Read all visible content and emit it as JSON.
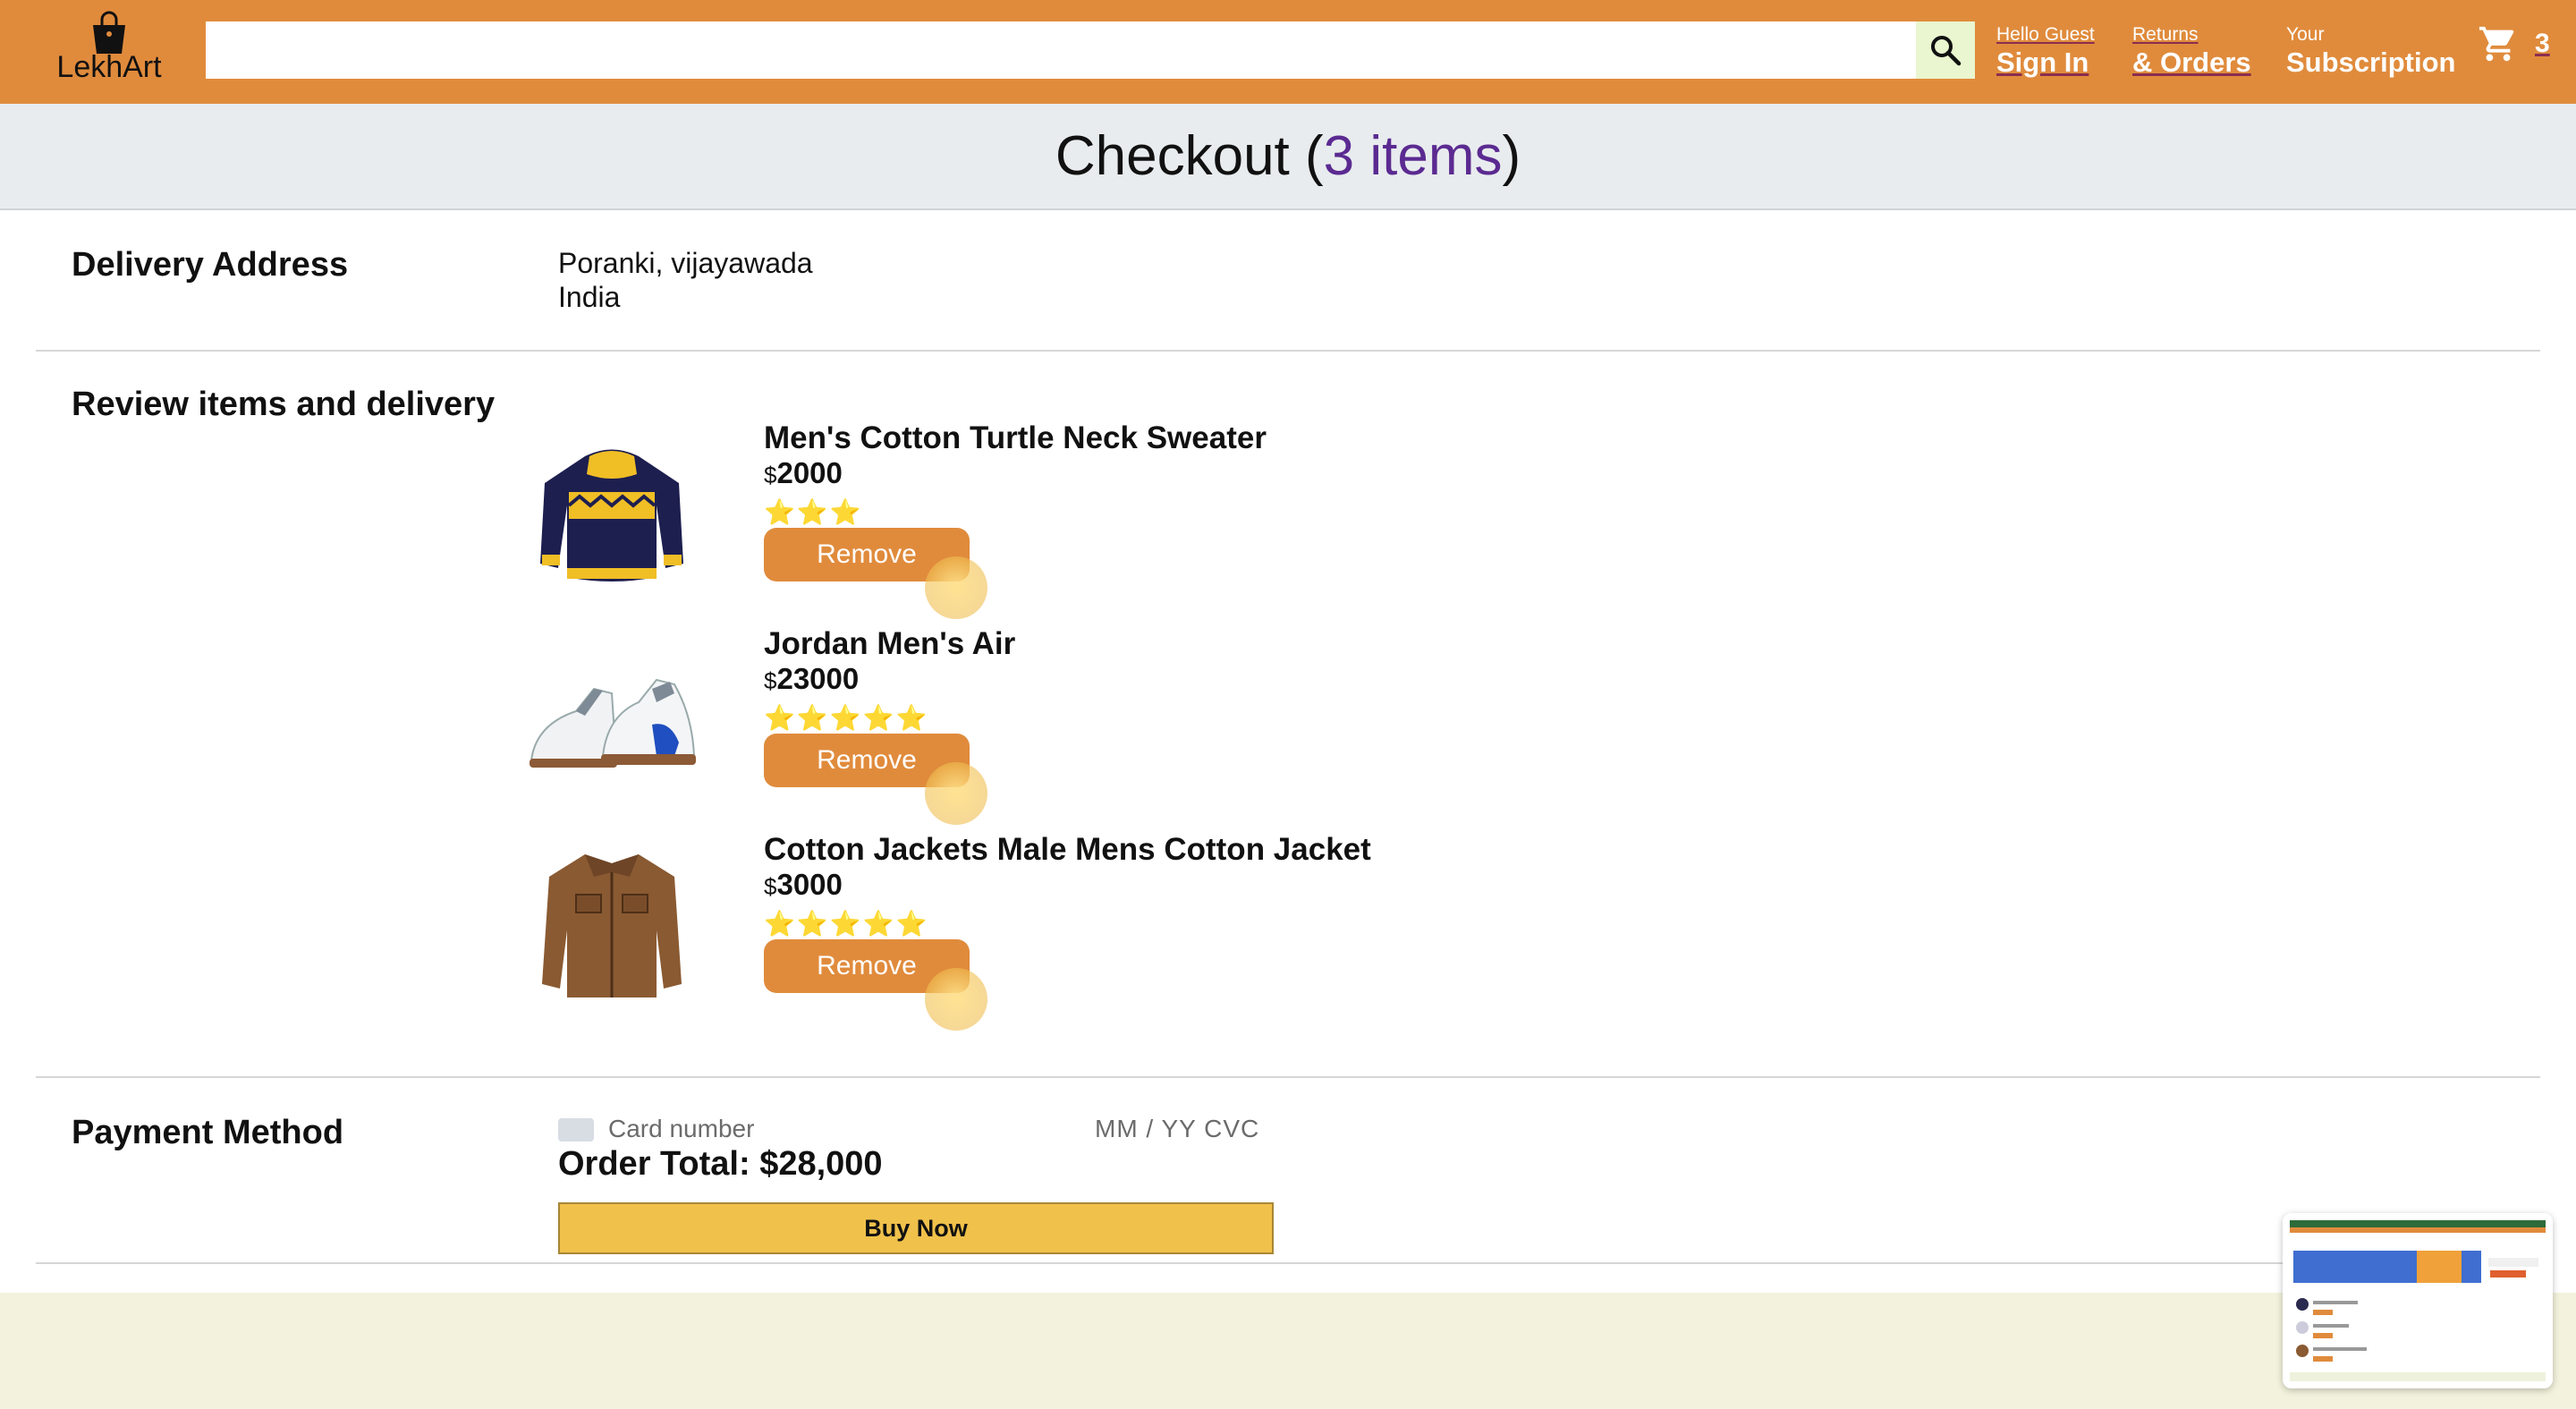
{
  "header": {
    "logo_text": "LekhArt",
    "search": {
      "value": "",
      "placeholder": ""
    },
    "greeting": "Hello Guest",
    "sign_in": "Sign In",
    "returns": "Returns",
    "orders": "& Orders",
    "your": "Your",
    "subscription": "Subscription",
    "cart_count": "3"
  },
  "title": {
    "prefix": "Checkout (",
    "count": "3 items",
    "suffix": ")"
  },
  "delivery": {
    "heading": "Delivery Address",
    "line1": "Poranki, vijayawada",
    "line2": "India"
  },
  "review": {
    "heading": "Review items and delivery",
    "items": [
      {
        "title": "Men's Cotton Turtle Neck Sweater",
        "currency": "$",
        "price": "2000",
        "stars": "⭐⭐⭐",
        "rating": 3,
        "remove_label": "Remove"
      },
      {
        "title": "Jordan Men's Air",
        "currency": "$",
        "price": "23000",
        "stars": "⭐⭐⭐⭐⭐",
        "rating": 5,
        "remove_label": "Remove"
      },
      {
        "title": "Cotton Jackets Male Mens Cotton Jacket",
        "currency": "$",
        "price": "3000",
        "stars": "⭐⭐⭐⭐⭐",
        "rating": 5,
        "remove_label": "Remove"
      }
    ]
  },
  "payment": {
    "heading": "Payment Method",
    "card_placeholder": "Card number",
    "expiry_cvc": "MM / YY  CVC",
    "order_total": "Order Total: $28,000",
    "buy_label": "Buy Now"
  },
  "colors": {
    "accent": "#e08b3c",
    "title_count": "#5b2a91",
    "buy_button": "#f0c14b"
  }
}
